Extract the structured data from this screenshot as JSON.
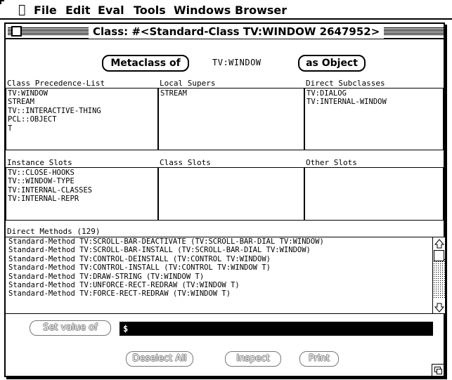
{
  "menubar": {
    "apple_icon": "apple-icon",
    "items": [
      "File",
      "Edit",
      "Eval",
      "Tools",
      "Windows",
      "Browser"
    ]
  },
  "window": {
    "title": "Class: #<Standard-Class TV:WINDOW 2647952>"
  },
  "buttons": {
    "metaclass": "Metaclass of",
    "as_object": "as Object",
    "set_value": "Set value of",
    "deselect_all": "Deselect All",
    "inspect": "Inspect",
    "print": "Print"
  },
  "object_name": "TV:WINDOW",
  "panes": {
    "class_precedence": {
      "label": "Class Precedence-List",
      "items": [
        "TV:WINDOW",
        "STREAM",
        "TV::INTERACTIVE-THING",
        "PCL::OBJECT",
        "T"
      ]
    },
    "local_supers": {
      "label": "Local Supers",
      "items": [
        "STREAM"
      ]
    },
    "direct_subclasses": {
      "label": "Direct Subclasses",
      "items": [
        "TV:DIALOG",
        "TV:INTERNAL-WINDOW"
      ]
    },
    "instance_slots": {
      "label": "Instance Slots",
      "items": [
        "TV::CLOSE-HOOKS",
        "TV::WINDOW-TYPE",
        "TV:INTERNAL-CLASSES",
        "TV:INTERNAL-REPR"
      ]
    },
    "class_slots": {
      "label": "Class Slots",
      "items": []
    },
    "other_slots": {
      "label": "Other Slots",
      "items": []
    }
  },
  "methods": {
    "label": "Direct Methods (129)",
    "items": [
      "Standard-Method TV:SCROLL-BAR-DEACTIVATE (TV:SCROLL-BAR-DIAL TV:WINDOW)",
      "Standard-Method TV:SCROLL-BAR-INSTALL (TV:SCROLL-BAR-DIAL TV:WINDOW)",
      "Standard-Method TV:CONTROL-DEINSTALL (TV:CONTROL TV:WINDOW)",
      "Standard-Method TV:CONTROL-INSTALL (TV:CONTROL TV:WINDOW T)",
      "Standard-Method TV:DRAW-STRING (TV:WINDOW T)",
      "Standard-Method TV:UNFORCE-RECT-REDRAW (TV:WINDOW T)",
      "Standard-Method TV:FORCE-RECT-REDRAW (TV:WINDOW T)"
    ]
  },
  "value_field": {
    "value": "$"
  }
}
